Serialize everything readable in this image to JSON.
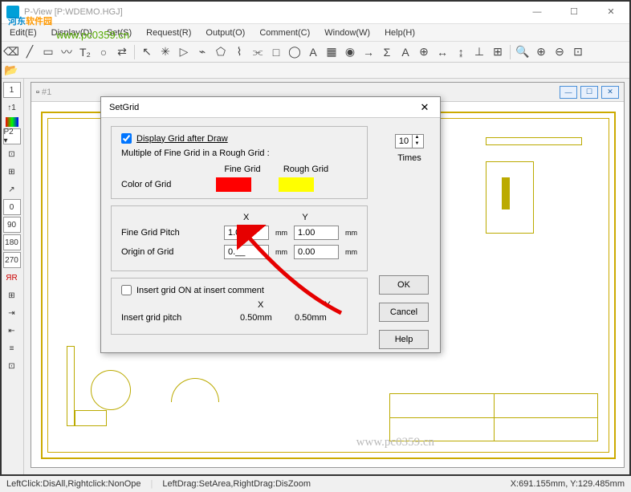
{
  "window": {
    "title": "P-View [P:WDEMO.HGJ]",
    "controls": {
      "min": "—",
      "max": "☐",
      "close": "✕"
    }
  },
  "menu": {
    "items": [
      "Edit(E)",
      "Display(D)",
      "Set(S)",
      "Request(R)",
      "Output(O)",
      "Comment(C)",
      "Window(W)",
      "Help(H)"
    ]
  },
  "watermark": {
    "brand_cn1": "河东",
    "brand_cn2": "软件园",
    "url": "www.pc0359.cn",
    "center": "www.pc0359.cn"
  },
  "child_window": {
    "title": "#1"
  },
  "left_panel": {
    "items": [
      "1",
      "↑1",
      "■",
      "P2 ▾",
      "",
      "",
      "",
      "0",
      "90",
      "180",
      "270",
      "ЯR",
      "",
      "",
      "",
      "",
      ""
    ]
  },
  "dialog": {
    "title": "SetGrid",
    "close": "✕",
    "display_grid_label": "Display Grid after Draw",
    "display_grid_checked": true,
    "multiple_label": "Multiple of Fine Grid in a Rough Grid :",
    "multiple_value": "10",
    "times_label": "Times",
    "color_label": "Color of Grid",
    "fine_grid_label": "Fine Grid",
    "rough_grid_label": "Rough Grid",
    "fine_color": "#ff0000",
    "rough_color": "#ffff00",
    "axis_x": "X",
    "axis_y": "Y",
    "fine_pitch_label": "Fine Grid Pitch",
    "fine_pitch_x": "1.00",
    "fine_pitch_y": "1.00",
    "origin_label": "Origin of Grid",
    "origin_x": "0.__",
    "origin_y": "0.00",
    "unit": "mm",
    "insert_on_label": "Insert grid ON at insert comment",
    "insert_on_checked": false,
    "insert_pitch_label": "Insert grid pitch",
    "insert_pitch_x": "0.50mm",
    "insert_pitch_y": "0.50mm",
    "ok": "OK",
    "cancel": "Cancel",
    "help": "Help"
  },
  "statusbar": {
    "left": "LeftClick:DisAll,Rightclick:NonOpe",
    "mid": "LeftDrag:SetArea,RightDrag:DisZoom",
    "coords": "X:691.155mm, Y:129.485mm"
  }
}
